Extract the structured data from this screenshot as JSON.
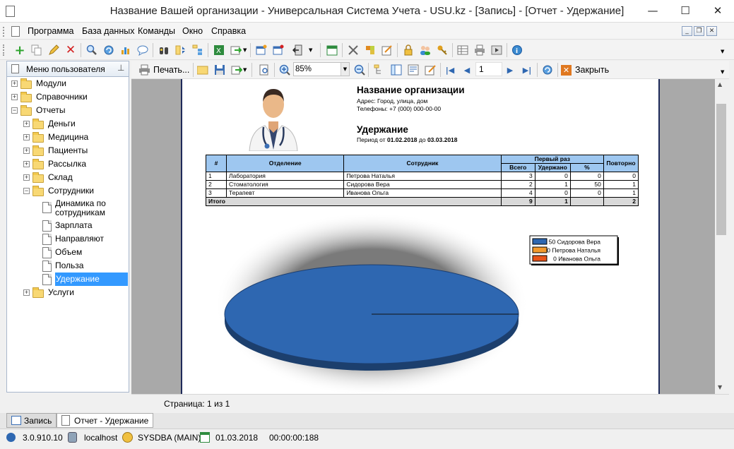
{
  "window": {
    "title": "Название Вашей организации - Универсальная Система Учета - USU.kz - [Запись] - [Отчет - Удержание]"
  },
  "menu": [
    "Программа",
    "База данных",
    "Команды",
    "Окно",
    "Справка"
  ],
  "panel": {
    "title": "Меню пользователя"
  },
  "tree": [
    {
      "label": "Модули",
      "level": 0,
      "type": "folder",
      "expand": "+"
    },
    {
      "label": "Справочники",
      "level": 0,
      "type": "folder",
      "expand": "+"
    },
    {
      "label": "Отчеты",
      "level": 0,
      "type": "folder",
      "expand": "-"
    },
    {
      "label": "Деньги",
      "level": 1,
      "type": "folder",
      "expand": "+"
    },
    {
      "label": "Медицина",
      "level": 1,
      "type": "folder",
      "expand": "+"
    },
    {
      "label": "Пациенты",
      "level": 1,
      "type": "folder",
      "expand": "+"
    },
    {
      "label": "Рассылка",
      "level": 1,
      "type": "folder",
      "expand": "+"
    },
    {
      "label": "Склад",
      "level": 1,
      "type": "folder",
      "expand": "+"
    },
    {
      "label": "Сотрудники",
      "level": 1,
      "type": "folder",
      "expand": "-"
    },
    {
      "label": "Динамика по\nсотрудникам",
      "level": 2,
      "type": "doc"
    },
    {
      "label": "Зарплата",
      "level": 2,
      "type": "doc"
    },
    {
      "label": "Направляют",
      "level": 2,
      "type": "doc"
    },
    {
      "label": "Объем",
      "level": 2,
      "type": "doc"
    },
    {
      "label": "Польза",
      "level": 2,
      "type": "doc"
    },
    {
      "label": "Удержание",
      "level": 2,
      "type": "doc",
      "selected": true
    },
    {
      "label": "Услуги",
      "level": 1,
      "type": "folder",
      "expand": "+"
    }
  ],
  "report_toolbar": {
    "print": "Печать...",
    "zoom": "85%",
    "page": "1",
    "close": "Закрыть"
  },
  "report": {
    "org": "Название организации",
    "address": "Адрес: Город, улица, дом",
    "phone": "Телефоны: +7 (000) 000-00-00",
    "title": "Удержание",
    "period_prefix": "Период от ",
    "date_from": "01.02.2018",
    "period_mid": " до ",
    "date_to": "03.03.2018",
    "headers": {
      "num": "#",
      "dept": "Отделение",
      "emp": "Сотрудник",
      "first": "Первый раз",
      "total": "Всего",
      "kept": "Удержано",
      "pct": "%",
      "repeat": "Повторно"
    },
    "rows": [
      [
        "1",
        "Лаборатория",
        "Петрова Наталья",
        "3",
        "0",
        "0",
        "0"
      ],
      [
        "2",
        "Стоматология",
        "Сидорова Вера",
        "2",
        "1",
        "50",
        "1"
      ],
      [
        "3",
        "Терапевт",
        "Иванова Ольга",
        "4",
        "0",
        "0",
        "1"
      ]
    ],
    "total": {
      "label": "Итого",
      "total": "9",
      "kept": "1",
      "pct": "",
      "repeat": "2"
    }
  },
  "chart_data": {
    "type": "pie",
    "series": [
      {
        "name": "Сидорова Вера",
        "value": 50,
        "color": "#2e67b1"
      },
      {
        "name": "Петрова Наталья",
        "value": 0,
        "color": "#f39a2e"
      },
      {
        "name": "Иванова Ольга",
        "value": 0,
        "color": "#e8541a"
      }
    ]
  },
  "page_status": "Страница: 1 из 1",
  "tabs": [
    "Запись",
    "Отчет - Удержание"
  ],
  "status": {
    "version": "3.0.910.10",
    "host": "localhost",
    "user": "SYSDBA (MAIN)",
    "date": "01.03.2018",
    "time": "00:00:00:188"
  }
}
